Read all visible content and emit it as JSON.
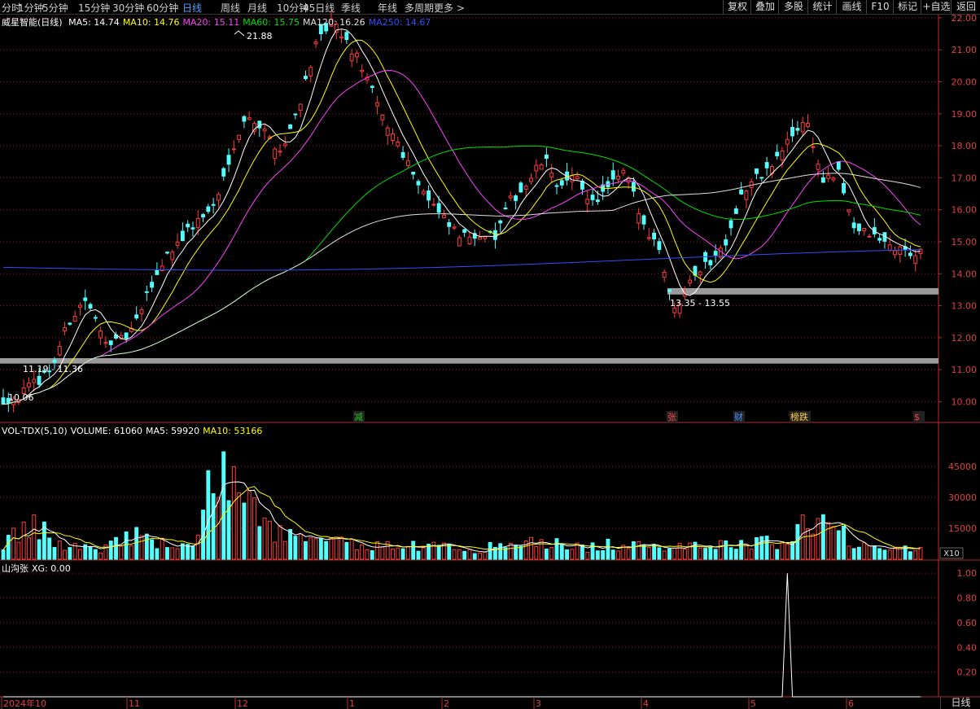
{
  "periods": [
    "分时",
    "1分钟",
    "5分钟",
    "15分钟",
    "30分钟",
    "60分钟",
    "日线",
    "周线",
    "月线",
    "10分钟",
    "45日线",
    "季线",
    "年线",
    "多周期",
    "更多 >"
  ],
  "active_period": "日线",
  "toolbar_right": [
    "复权",
    "叠加",
    "多股",
    "统计",
    "画线",
    "F10",
    "标记",
    "+自选",
    "返回"
  ],
  "stock_name": "威星智能(日线)",
  "ma_legend": [
    {
      "label": "MA5: 14.74",
      "color": "#ffffff"
    },
    {
      "label": "MA10: 14.76",
      "color": "#ffff00"
    },
    {
      "label": "MA20: 15.11",
      "color": "#ff40ff"
    },
    {
      "label": "MA60: 15.75",
      "color": "#00e000"
    },
    {
      "label": "MA120: 16.26",
      "color": "#e0e0e0"
    },
    {
      "label": "MA250: 14.67",
      "color": "#3050ff"
    }
  ],
  "vol_legend": [
    {
      "label": "VOL-TDX(5,10)",
      "color": "#ffffff"
    },
    {
      "label": "VOLUME: 61060",
      "color": "#ffffff"
    },
    {
      "label": "MA5: 59920",
      "color": "#ffffff"
    },
    {
      "label": "MA10: 53166",
      "color": "#ffff00"
    }
  ],
  "ind_legend": [
    {
      "label": "山沟张",
      "color": "#ffffff"
    },
    {
      "label": "XG: 0.00",
      "color": "#ffffff"
    }
  ],
  "bottom_right_label": "日线",
  "x10_label": "X10",
  "colors": {
    "up": "#ff3c3c",
    "down": "#54ffff",
    "grid": "#8b1a1a",
    "axis": "#b03030"
  },
  "chart_data": {
    "type": "candlestick",
    "price_axis": {
      "ticks": [
        "22.00",
        "21.00",
        "20.00",
        "19.00",
        "18.00",
        "17.00",
        "16.00",
        "15.00",
        "14.00",
        "13.00",
        "12.00",
        "11.00",
        "10.00"
      ],
      "ylim": [
        9.4,
        22.1
      ]
    },
    "volume_axis": {
      "ticks": [
        "45000",
        "30000",
        "15000"
      ],
      "ylim": [
        0,
        60000
      ]
    },
    "indicator_axis": {
      "ticks": [
        "1.00",
        "0.80",
        "0.60",
        "0.40",
        "0.20"
      ],
      "ylim": [
        0,
        1.1
      ]
    },
    "date_labels": [
      "2024年10",
      "11",
      "12",
      "1",
      "2",
      "3",
      "4",
      "5",
      "6"
    ],
    "annotations": {
      "high": "21.88",
      "low": "10.06",
      "zone1": "11.19 - 11.36",
      "zone2": "13.35 - 13.55"
    },
    "events": [
      "减",
      "张",
      "财",
      "榜跌",
      "$"
    ],
    "support_zones": [
      [
        11.19,
        11.36
      ],
      [
        13.35,
        13.55
      ]
    ],
    "price_anchors": [
      10.06,
      10.2,
      10.6,
      11.1,
      12.5,
      13.2,
      12.1,
      11.8,
      12.3,
      13.6,
      14.6,
      15.2,
      15.7,
      16.2,
      18.0,
      19.0,
      18.4,
      17.8,
      19.2,
      21.0,
      21.88,
      21.2,
      20.4,
      19.0,
      18.2,
      17.2,
      16.3,
      15.6,
      15.1,
      15.3,
      15.1,
      16.3,
      16.8,
      17.6,
      16.7,
      17.0,
      16.2,
      16.7,
      17.2,
      15.6,
      14.9,
      12.8,
      14.0,
      14.3,
      14.9,
      16.4,
      17.0,
      17.4,
      18.2,
      18.9,
      16.9,
      17.1,
      15.4,
      15.2,
      14.9,
      14.7,
      14.6
    ],
    "volume_anchors": [
      8000,
      12000,
      16000,
      9000,
      6000,
      7000,
      5000,
      9000,
      12000,
      8000,
      7000,
      6000,
      9000,
      52000,
      35000,
      25000,
      18000,
      12000,
      10000,
      8000,
      9000,
      7000,
      8000,
      6000,
      7000,
      7000,
      6000,
      6000,
      5000,
      5000,
      6000,
      7000,
      8000,
      8000,
      7000,
      6000,
      6000,
      7000,
      6000,
      6000,
      5000,
      8000,
      8000,
      7000,
      7000,
      7000,
      8000,
      8000,
      10000,
      20000,
      16000,
      13000,
      9000,
      7000,
      6000,
      6000,
      6000
    ],
    "xg_spike_date_index": 153
  }
}
